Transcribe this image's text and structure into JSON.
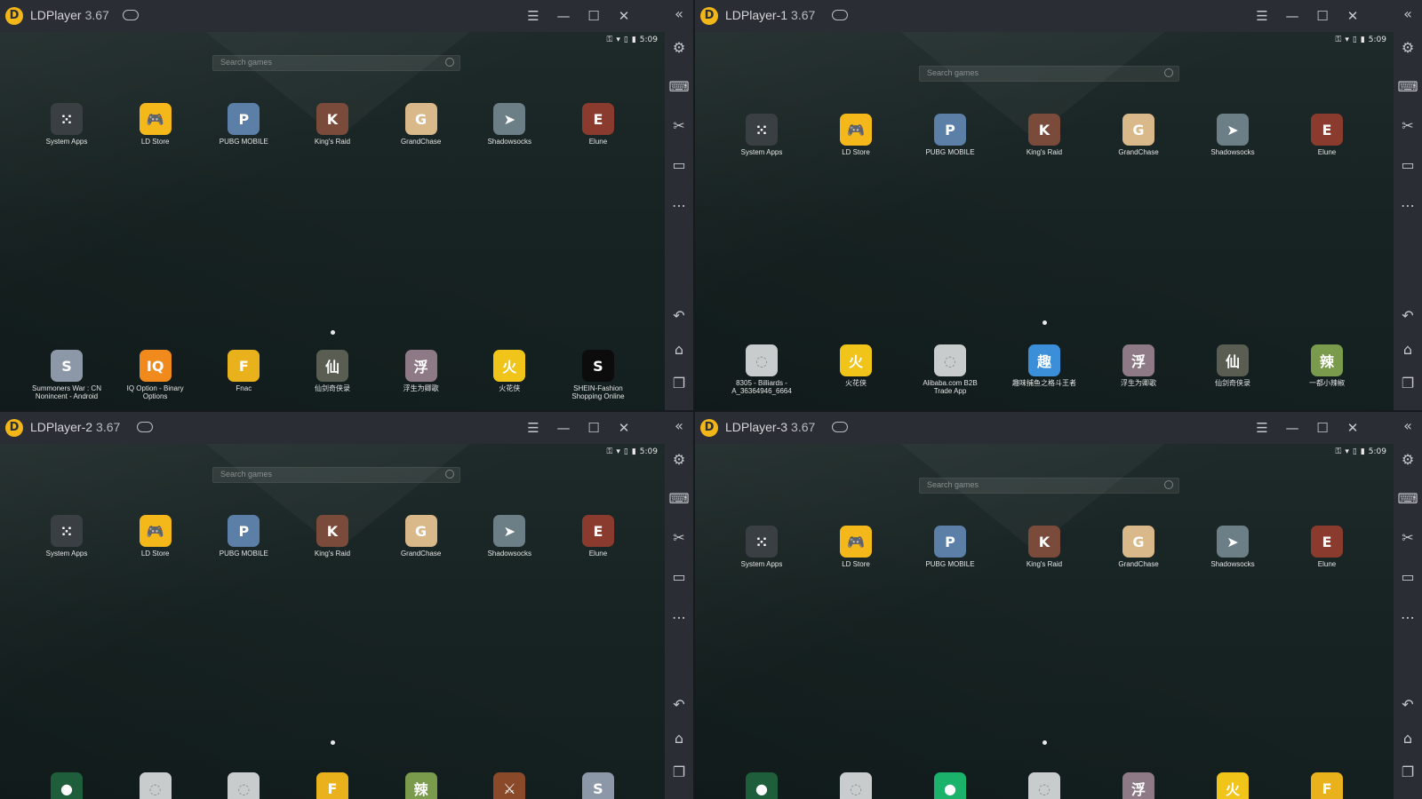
{
  "windows": [
    {
      "title": "LDPlayer",
      "version": "3.67",
      "status_time": "5:09",
      "search_placeholder": "Search games",
      "top_apps": [
        {
          "label": "System Apps",
          "icon": "apps-grid-icon",
          "bg": "#3a3f44"
        },
        {
          "label": "LD Store",
          "icon": "gamepad-icon",
          "bg": "#f5b81b"
        },
        {
          "label": "PUBG MOBILE",
          "icon": "pubg-icon",
          "bg": "#5b7fa6"
        },
        {
          "label": "King's Raid",
          "icon": "kings-raid-icon",
          "bg": "#7a4a3a"
        },
        {
          "label": "GrandChase",
          "icon": "grandchase-icon",
          "bg": "#d9b98a"
        },
        {
          "label": "Shadowsocks",
          "icon": "paper-plane-icon",
          "bg": "#6d7f86"
        },
        {
          "label": "Elune",
          "icon": "elune-icon",
          "bg": "#8b3b2e"
        }
      ],
      "bottom_apps": [
        {
          "label": "Summoners War : CN Nonincent - Android",
          "icon": "summoners-war-icon",
          "bg": "#8c97a8"
        },
        {
          "label": "IQ Option - Binary Options",
          "icon": "iq-option-icon",
          "bg": "#f08a1c"
        },
        {
          "label": "Fnac",
          "icon": "fnac-icon",
          "bg": "#e9b21c"
        },
        {
          "label": "仙剑奇侠录",
          "icon": "xianjian-icon",
          "bg": "#5a5d52"
        },
        {
          "label": "浮生为卿歌",
          "icon": "fusheng-icon",
          "bg": "#8e7a86"
        },
        {
          "label": "火花侠",
          "icon": "huohua-icon",
          "bg": "#f0c419"
        },
        {
          "label": "SHEIN-Fashion Shopping Online",
          "icon": "shein-icon",
          "bg": "#0c0c0c"
        }
      ]
    },
    {
      "title": "LDPlayer-1",
      "version": "3.67",
      "status_time": "5:09",
      "search_placeholder": "Search games",
      "top_apps": [
        {
          "label": "System Apps",
          "icon": "apps-grid-icon",
          "bg": "#3a3f44"
        },
        {
          "label": "LD Store",
          "icon": "gamepad-icon",
          "bg": "#f5b81b"
        },
        {
          "label": "PUBG MOBILE",
          "icon": "pubg-icon",
          "bg": "#5b7fa6"
        },
        {
          "label": "King's Raid",
          "icon": "kings-raid-icon",
          "bg": "#7a4a3a"
        },
        {
          "label": "GrandChase",
          "icon": "grandchase-icon",
          "bg": "#d9b98a"
        },
        {
          "label": "Shadowsocks",
          "icon": "paper-plane-icon",
          "bg": "#6d7f86"
        },
        {
          "label": "Elune",
          "icon": "elune-icon",
          "bg": "#8b3b2e"
        }
      ],
      "bottom_apps": [
        {
          "label": "8305 - Billiards - A_36364946_6664",
          "icon": "placeholder-app-icon",
          "bg": "#c9cccc"
        },
        {
          "label": "火花侠",
          "icon": "huohua-icon",
          "bg": "#f0c419"
        },
        {
          "label": "Alibaba.com B2B Trade App",
          "icon": "placeholder-app-icon",
          "bg": "#c9cccc"
        },
        {
          "label": "趣味捕鱼之格斗王者",
          "icon": "fishing-icon",
          "bg": "#3a8fd8"
        },
        {
          "label": "浮生为卿歌",
          "icon": "fusheng-icon",
          "bg": "#8e7a86"
        },
        {
          "label": "仙剑奇侠录",
          "icon": "xianjian-icon",
          "bg": "#5a5d52"
        },
        {
          "label": "一都小辣椒",
          "icon": "pepper-icon",
          "bg": "#7a9a4c"
        }
      ]
    },
    {
      "title": "LDPlayer-2",
      "version": "3.67",
      "status_time": "5:09",
      "search_placeholder": "Search games",
      "top_apps": [
        {
          "label": "System Apps",
          "icon": "apps-grid-icon",
          "bg": "#3a3f44"
        },
        {
          "label": "LD Store",
          "icon": "gamepad-icon",
          "bg": "#f5b81b"
        },
        {
          "label": "PUBG MOBILE",
          "icon": "pubg-icon",
          "bg": "#5b7fa6"
        },
        {
          "label": "King's Raid",
          "icon": "kings-raid-icon",
          "bg": "#7a4a3a"
        },
        {
          "label": "GrandChase",
          "icon": "grandchase-icon",
          "bg": "#d9b98a"
        },
        {
          "label": "Shadowsocks",
          "icon": "paper-plane-icon",
          "bg": "#6d7f86"
        },
        {
          "label": "Elune",
          "icon": "elune-icon",
          "bg": "#8b3b2e"
        }
      ],
      "bottom_apps": [
        {
          "label": "",
          "icon": "game-ball-icon",
          "bg": "#1e5e3a"
        },
        {
          "label": "",
          "icon": "placeholder-app-icon",
          "bg": "#c9cccc"
        },
        {
          "label": "",
          "icon": "placeholder-app-icon",
          "bg": "#c9cccc"
        },
        {
          "label": "",
          "icon": "fnac-icon",
          "bg": "#e9b21c"
        },
        {
          "label": "",
          "icon": "pepper-icon",
          "bg": "#7a9a4c"
        },
        {
          "label": "",
          "icon": "warrior-icon",
          "bg": "#8a4a2a"
        },
        {
          "label": "",
          "icon": "summoners-war-icon",
          "bg": "#8c97a8"
        }
      ]
    },
    {
      "title": "LDPlayer-3",
      "version": "3.67",
      "status_time": "5:09",
      "search_placeholder": "Search games",
      "top_apps": [
        {
          "label": "System Apps",
          "icon": "apps-grid-icon",
          "bg": "#3a3f44"
        },
        {
          "label": "LD Store",
          "icon": "gamepad-icon",
          "bg": "#f5b81b"
        },
        {
          "label": "PUBG MOBILE",
          "icon": "pubg-icon",
          "bg": "#5b7fa6"
        },
        {
          "label": "King's Raid",
          "icon": "kings-raid-icon",
          "bg": "#7a4a3a"
        },
        {
          "label": "GrandChase",
          "icon": "grandchase-icon",
          "bg": "#d9b98a"
        },
        {
          "label": "Shadowsocks",
          "icon": "paper-plane-icon",
          "bg": "#6d7f86"
        },
        {
          "label": "Elune",
          "icon": "elune-icon",
          "bg": "#8b3b2e"
        }
      ],
      "bottom_apps": [
        {
          "label": "",
          "icon": "game-ball-icon",
          "bg": "#1e5e3a"
        },
        {
          "label": "",
          "icon": "placeholder-app-icon",
          "bg": "#c9cccc"
        },
        {
          "label": "",
          "icon": "cleaner-icon",
          "bg": "#1bb26b"
        },
        {
          "label": "",
          "icon": "placeholder-app-icon",
          "bg": "#c9cccc"
        },
        {
          "label": "",
          "icon": "fusheng-icon",
          "bg": "#8e7a86"
        },
        {
          "label": "",
          "icon": "huohua-icon",
          "bg": "#f0c419"
        },
        {
          "label": "",
          "icon": "fnac-icon",
          "bg": "#e9b21c"
        }
      ]
    }
  ],
  "titlebar_controls": [
    "menu-icon",
    "minimize-icon",
    "maximize-icon",
    "close-icon"
  ],
  "sidebar_tools": [
    "collapse-icon",
    "settings-gear-icon",
    "keyboard-icon",
    "scissors-icon",
    "video-record-icon",
    "more-icon",
    "back-icon",
    "home-icon",
    "recent-apps-icon"
  ],
  "colors": {
    "titlebar": "#2a2d33",
    "accent": "#f2b619"
  }
}
